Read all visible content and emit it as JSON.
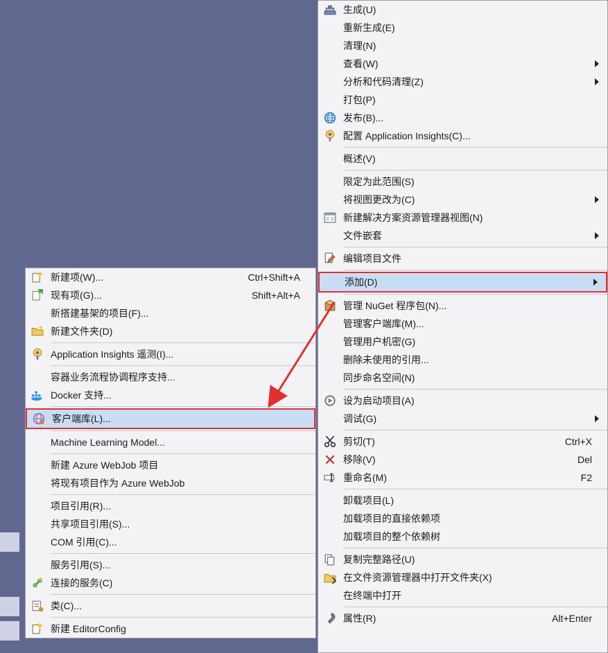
{
  "submenu": {
    "items": [
      {
        "id": "new-item",
        "label": "新建项(W)...",
        "shortcut": "Ctrl+Shift+A",
        "icon": "new-item"
      },
      {
        "id": "existing-item",
        "label": "现有项(G)...",
        "shortcut": "Shift+Alt+A",
        "icon": "existing-item"
      },
      {
        "id": "scaffolded",
        "label": "新搭建基架的项目(F)...",
        "icon": ""
      },
      {
        "id": "new-folder",
        "label": "新建文件夹(D)",
        "icon": "folder-new"
      },
      {
        "sep": true
      },
      {
        "id": "app-insights",
        "label": "Application Insights 遥测(I)...",
        "icon": "app-insights"
      },
      {
        "sep": true
      },
      {
        "id": "container",
        "label": "容器业务流程协调程序支持...",
        "icon": ""
      },
      {
        "id": "docker",
        "label": "Docker 支持...",
        "icon": "docker"
      },
      {
        "sep": true
      },
      {
        "id": "client-lib",
        "label": "客户端库(L)...",
        "icon": "client-lib",
        "highlight": true,
        "boxed": true
      },
      {
        "sep": true
      },
      {
        "id": "ml-model",
        "label": "Machine Learning Model...",
        "icon": ""
      },
      {
        "sep": true
      },
      {
        "id": "azure-new",
        "label": "新建 Azure WebJob 项目",
        "icon": ""
      },
      {
        "id": "azure-exist",
        "label": "将现有项目作为 Azure WebJob",
        "icon": ""
      },
      {
        "sep": true
      },
      {
        "id": "proj-ref",
        "label": "项目引用(R)...",
        "icon": ""
      },
      {
        "id": "shared-ref",
        "label": "共享项目引用(S)...",
        "icon": ""
      },
      {
        "id": "com-ref",
        "label": "COM 引用(C)...",
        "icon": ""
      },
      {
        "sep": true
      },
      {
        "id": "svc-ref",
        "label": "服务引用(S)...",
        "icon": ""
      },
      {
        "id": "conn-svc",
        "label": "连接的服务(C)",
        "icon": "connected-svc"
      },
      {
        "sep": true
      },
      {
        "id": "class",
        "label": "类(C)...",
        "icon": "class"
      },
      {
        "sep": true
      },
      {
        "id": "editorconfig",
        "label": "新建 EditorConfig",
        "icon": "new-item"
      }
    ]
  },
  "main": {
    "items": [
      {
        "id": "build",
        "label": "生成(U)",
        "icon": "build"
      },
      {
        "id": "rebuild",
        "label": "重新生成(E)"
      },
      {
        "id": "clean",
        "label": "清理(N)"
      },
      {
        "id": "view",
        "label": "查看(W)",
        "sub": true
      },
      {
        "id": "analyze",
        "label": "分析和代码清理(Z)",
        "sub": true
      },
      {
        "id": "pack",
        "label": "打包(P)"
      },
      {
        "id": "publish",
        "label": "发布(B)...",
        "icon": "globe"
      },
      {
        "id": "insights-cfg",
        "label": "配置 Application Insights(C)...",
        "icon": "app-insights"
      },
      {
        "sep": true
      },
      {
        "id": "overview",
        "label": "概述(V)"
      },
      {
        "sep": true
      },
      {
        "id": "scope",
        "label": "限定为此范围(S)"
      },
      {
        "id": "change-view",
        "label": "将视图更改为(C)",
        "sub": true
      },
      {
        "id": "new-sln",
        "label": "新建解决方案资源管理器视图(N)",
        "icon": "solution"
      },
      {
        "id": "file-nest",
        "label": "文件嵌套",
        "sub": true
      },
      {
        "sep": true
      },
      {
        "id": "edit-proj",
        "label": "编辑项目文件",
        "icon": "edit-file"
      },
      {
        "sep": true
      },
      {
        "id": "add",
        "label": "添加(D)",
        "sub": true,
        "highlight": true,
        "boxed": true
      },
      {
        "sep": true
      },
      {
        "id": "nuget",
        "label": "管理 NuGet 程序包(N)...",
        "icon": "nuget"
      },
      {
        "id": "client",
        "label": "管理客户端库(M)..."
      },
      {
        "id": "secrets",
        "label": "管理用户机密(G)"
      },
      {
        "id": "unused",
        "label": "删除未使用的引用..."
      },
      {
        "id": "sync-ns",
        "label": "同步命名空间(N)"
      },
      {
        "sep": true
      },
      {
        "id": "startup",
        "label": "设为启动项目(A)",
        "icon": "startup"
      },
      {
        "id": "debug",
        "label": "调试(G)",
        "sub": true
      },
      {
        "sep": true
      },
      {
        "id": "cut",
        "label": "剪切(T)",
        "shortcut": "Ctrl+X",
        "icon": "cut"
      },
      {
        "id": "remove",
        "label": "移除(V)",
        "shortcut": "Del",
        "icon": "remove"
      },
      {
        "id": "rename",
        "label": "重命名(M)",
        "shortcut": "F2",
        "icon": "rename"
      },
      {
        "sep": true
      },
      {
        "id": "unload",
        "label": "卸载项目(L)"
      },
      {
        "id": "deps-direct",
        "label": "加载项目的直接依赖项"
      },
      {
        "id": "deps-all",
        "label": "加载项目的整个依赖树"
      },
      {
        "sep": true
      },
      {
        "id": "copy-path",
        "label": "复制完整路径(U)",
        "icon": "copy"
      },
      {
        "id": "open-folder",
        "label": "在文件资源管理器中打开文件夹(X)",
        "icon": "folder-open"
      },
      {
        "id": "open-term",
        "label": "在终端中打开"
      },
      {
        "sep": true
      },
      {
        "id": "props",
        "label": "属性(R)",
        "shortcut": "Alt+Enter",
        "icon": "wrench"
      }
    ]
  }
}
